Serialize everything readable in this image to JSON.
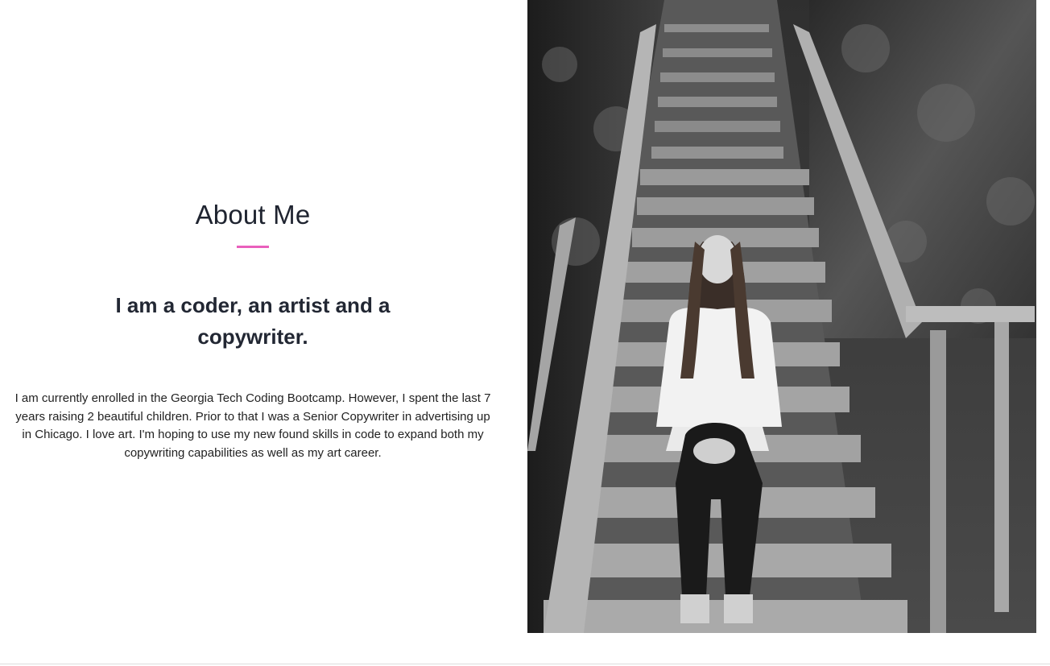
{
  "about": {
    "title": "About Me",
    "tagline": "I am a coder, an artist and a copywriter.",
    "bio": "I am currently enrolled in the Georgia Tech Coding Bootcamp. However, I spent the last 7 years raising 2 beautiful children. Prior to that I was a Senior Copywriter in advertising up in Chicago. I love art. I'm hoping to use my new found skills in code to expand both my copywriting capabilities as well as my art career."
  },
  "colors": {
    "accent": "#e95fbc",
    "text": "#1f2430"
  },
  "photo": {
    "icon": "portrait-photo",
    "style": "black-and-white"
  }
}
